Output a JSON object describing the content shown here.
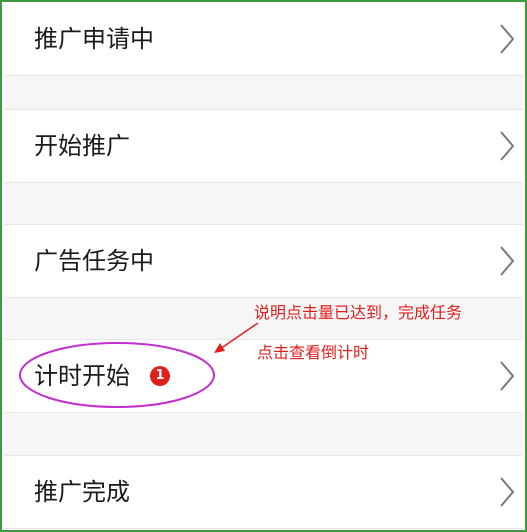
{
  "menu": {
    "items": [
      {
        "label": "推广申请中"
      },
      {
        "label": "开始推广"
      },
      {
        "label": "广告任务中"
      },
      {
        "label": "计时开始",
        "badge": "1"
      },
      {
        "label": "推广完成"
      }
    ]
  },
  "annotation": {
    "line1": "说明点击量已达到，完成任务",
    "line2": "点击查看倒计时"
  },
  "colors": {
    "frame_border": "#3f9a3f",
    "badge_red": "#e0201b",
    "annotation_red": "#e02020",
    "ellipse_purple": "#c22fd0"
  },
  "icons": {
    "row_chevron": "chevron-right-icon"
  }
}
